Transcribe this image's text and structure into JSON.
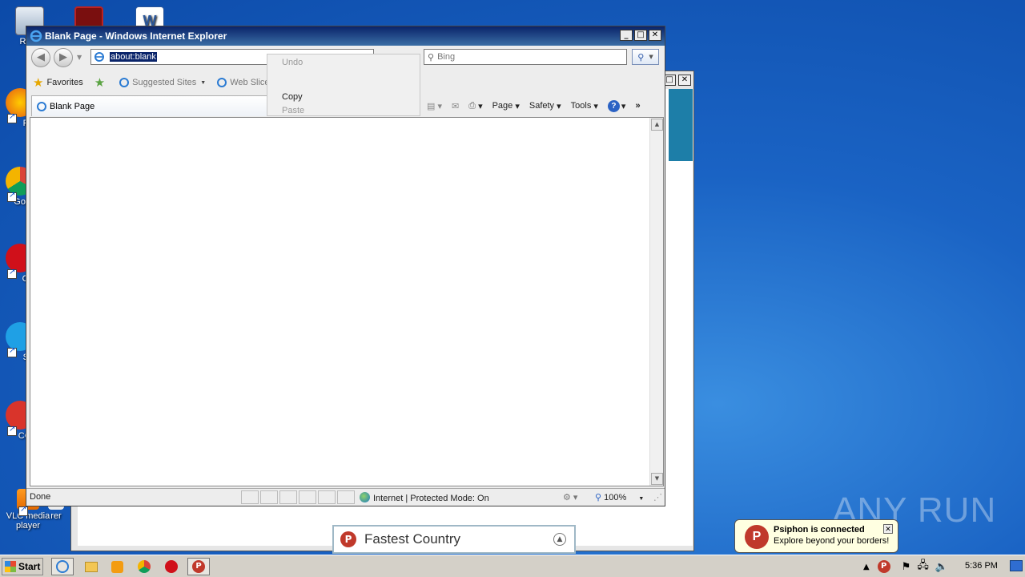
{
  "desktop": {
    "icons": [
      {
        "label": "Recy"
      },
      {
        "label": "Fir"
      },
      {
        "label": "Go Chr"
      },
      {
        "label": "Op"
      },
      {
        "label": "Sk"
      },
      {
        "label": "CCle"
      },
      {
        "label": "VLC media player"
      },
      {
        "label": "rer"
      }
    ]
  },
  "ie": {
    "title": "Blank Page - Windows Internet Explorer",
    "address": "about:blank",
    "search_placeholder": "Bing",
    "favorites_label": "Favorites",
    "favbar_items": [
      "Suggested Sites",
      "Web Slice Gallery"
    ],
    "tab_title": "Blank Page",
    "commands": {
      "page": "Page",
      "safety": "Safety",
      "tools": "Tools"
    },
    "context_menu": {
      "undo": "Undo",
      "copy": "Copy",
      "paste": "Paste"
    },
    "status": {
      "text": "Done",
      "zone": "Internet | Protected Mode: On",
      "zoom": "100%"
    }
  },
  "psiphon": {
    "fastest_country": "Fastest Country",
    "balloon_title": "Psiphon is connected",
    "balloon_text": "Explore beyond your borders!"
  },
  "watermark": "ANY RUN",
  "taskbar": {
    "start_label": "Start",
    "clock": "5:36 PM"
  },
  "colors": {
    "desktop_blue": "#1a63c4",
    "title_bar": "#0a246a",
    "psiphon_red": "#c0392b",
    "balloon_bg": "#ffffe1"
  }
}
